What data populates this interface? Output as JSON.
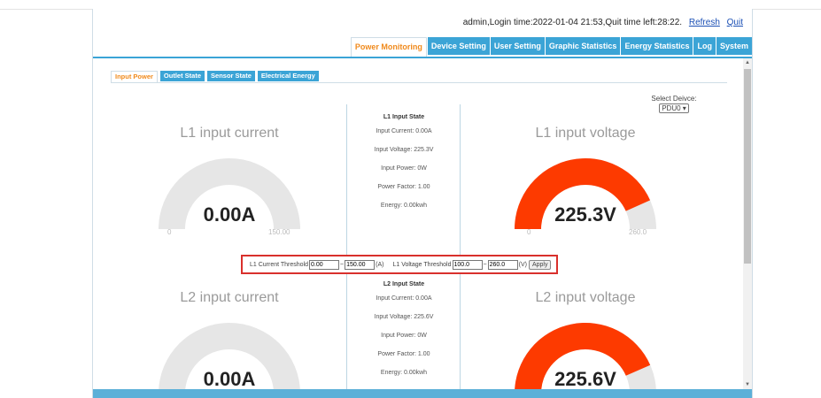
{
  "header": {
    "login_text": "admin,Login time:2022-01-04 21:53,Quit time left:28:22.",
    "refresh": "Refresh",
    "quit": "Quit"
  },
  "main_tabs": [
    "Power Monitoring",
    "Device Setting",
    "User Setting",
    "Graphic Statistics",
    "Energy Statistics",
    "Log",
    "System"
  ],
  "sub_tabs": [
    "Input Power",
    "Outlet State",
    "Sensor State",
    "Electrical Energy"
  ],
  "select_device": {
    "label": "Select Deivce:",
    "value": "PDU0 ▾"
  },
  "l1": {
    "current_title": "L1 input current",
    "current_value": "0.00A",
    "current_min": "0",
    "current_max": "150.00",
    "current_fraction": 0,
    "voltage_title": "L1 input voltage",
    "voltage_value": "225.3V",
    "voltage_min": "0",
    "voltage_max": "260.0",
    "voltage_fraction": 0.8665,
    "state": {
      "title": "L1 Input State",
      "input_current": "Input Current:  0.00A",
      "input_voltage": "Input Voltage:  225.3V",
      "input_power": "Input Power:  0W",
      "power_factor": "Power Factor:  1.00",
      "energy": "Energy:  0.00kwh"
    }
  },
  "threshold": {
    "current_label": "L1 Current Threshold",
    "current_low": "0.00",
    "current_high": "150.00",
    "current_unit": "(A)",
    "voltage_label": "L1 Voltage Threshold",
    "voltage_low": "100.0",
    "voltage_high": "260.0",
    "voltage_unit": "(V)",
    "tilde": "~",
    "apply": "Apply"
  },
  "l2": {
    "current_title": "L2 input current",
    "current_value": "0.00A",
    "current_fraction": 0,
    "voltage_title": "L2 input voltage",
    "voltage_value": "225.6V",
    "voltage_fraction": 0.8677,
    "state": {
      "title": "L2 Input State",
      "input_current": "Input Current:  0.00A",
      "input_voltage": "Input Voltage:  225.6V",
      "input_power": "Input Power:  0W",
      "power_factor": "Power Factor:  1.00",
      "energy": "Energy:  0.00kwh"
    }
  },
  "colors": {
    "accent": "#3ba4d6",
    "active_tab_text": "#f08a1c",
    "gauge_fill": "#fd3a00",
    "gauge_track": "#e6e6e6",
    "highlight_border": "#d9302c"
  }
}
